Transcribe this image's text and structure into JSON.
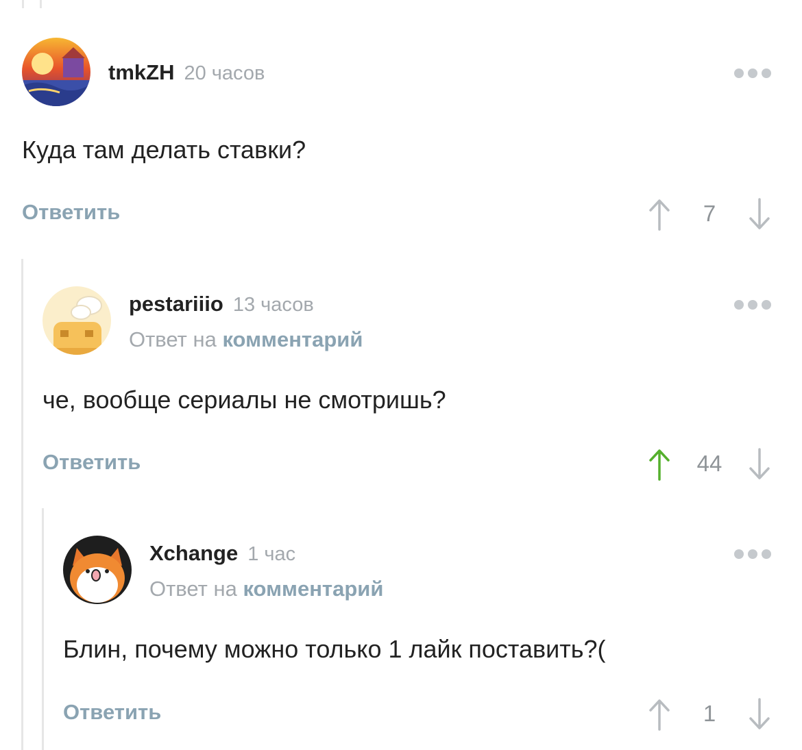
{
  "comments": [
    {
      "username": "tmkZH",
      "time": "20 часов",
      "reply_to": null,
      "text": "Куда там делать ставки?",
      "reply_label": "Ответить",
      "score": "7",
      "upvoted": false
    },
    {
      "username": "pestariiio",
      "time": "13 часов",
      "reply_to_prefix": "Ответ на",
      "reply_to_link": "комментарий",
      "text": "че, вообще сериалы не смотришь?",
      "reply_label": "Ответить",
      "score": "44",
      "upvoted": true
    },
    {
      "username": "Xchange",
      "time": "1 час",
      "reply_to_prefix": "Ответ на",
      "reply_to_link": "комментарий",
      "text": "Блин, почему можно только 1 лайк поставить?(",
      "reply_label": "Ответить",
      "score": "1",
      "upvoted": false
    }
  ],
  "colors": {
    "upvote_active": "#55b02d",
    "arrow_inactive": "#b8bcc0",
    "link": "#8aa3b2",
    "muted": "#a3a8ad"
  },
  "icons": {
    "more": "more-dots-icon",
    "up": "arrow-up-icon",
    "down": "arrow-down-icon"
  }
}
